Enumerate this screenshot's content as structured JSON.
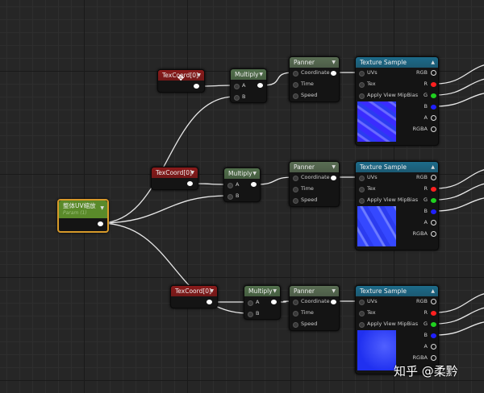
{
  "param": {
    "title": "整体UV缩放",
    "subtitle": "Param (1)"
  },
  "rows": [
    {
      "texcoord": "TexCoord[0]",
      "multiply": "Multiply",
      "panner": "Panner",
      "texture": "Texture Sample"
    },
    {
      "texcoord": "TexCoord[0]",
      "multiply": "Multiply",
      "panner": "Panner",
      "texture": "Texture Sample"
    },
    {
      "texcoord": "TexCoord[0]",
      "multiply": "Multiply",
      "panner": "Panner",
      "texture": "Texture Sample"
    }
  ],
  "multiply_inputs": [
    "A",
    "B"
  ],
  "panner_inputs": [
    "Coordinate",
    "Time",
    "Speed"
  ],
  "texture_inputs": [
    "UVs",
    "Tex",
    "Apply View MipBias"
  ],
  "texture_outputs": [
    "RGB",
    "R",
    "G",
    "B",
    "A",
    "RGBA"
  ],
  "colors": {
    "texcoord": "#8a1a1a",
    "multiply": "#52704c",
    "panner": "#5a6e54",
    "texture": "#1d6b8a",
    "param": "#5a8a2a",
    "param_border": "#d79a2a",
    "pin_r": "#ff2020",
    "pin_g": "#20d020",
    "pin_b": "#2020ff"
  },
  "watermark": "知乎 @柔黔"
}
